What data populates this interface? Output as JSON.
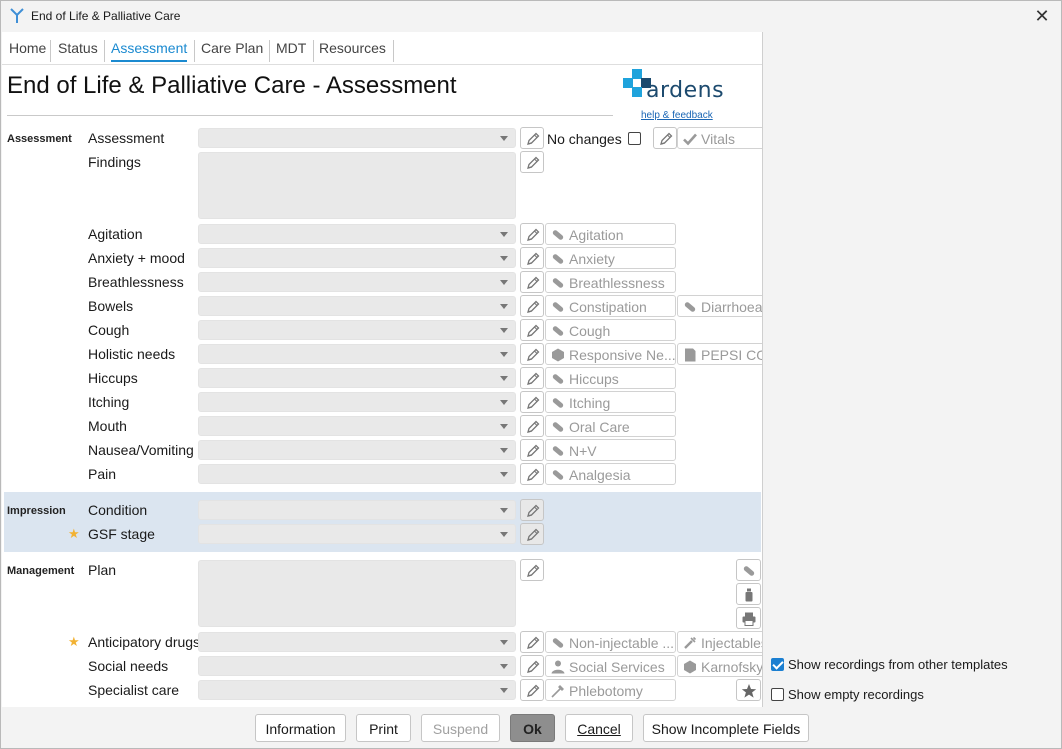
{
  "window": {
    "title": "End of Life & Palliative Care"
  },
  "tabs": [
    {
      "label": "Home"
    },
    {
      "label": "Status"
    },
    {
      "label": "Assessment"
    },
    {
      "label": "Care Plan"
    },
    {
      "label": "MDT"
    },
    {
      "label": "Resources"
    }
  ],
  "page": {
    "title": "End of Life & Palliative Care - Assessment"
  },
  "logo": {
    "text": "ardens",
    "help": "help & feedback"
  },
  "sections": {
    "assessment": "Assessment",
    "impression": "Impression",
    "management": "Management"
  },
  "assessment": {
    "rows": [
      {
        "label": "Assessment"
      },
      {
        "label": "Findings"
      },
      {
        "label": "Agitation"
      },
      {
        "label": "Anxiety + mood"
      },
      {
        "label": "Breathlessness"
      },
      {
        "label": "Bowels"
      },
      {
        "label": "Cough"
      },
      {
        "label": "Holistic needs"
      },
      {
        "label": "Hiccups"
      },
      {
        "label": "Itching"
      },
      {
        "label": "Mouth"
      },
      {
        "label": "Nausea/Vomiting"
      },
      {
        "label": "Pain"
      }
    ],
    "no_changes": "No changes",
    "tags": {
      "vitals": "Vitals",
      "agitation": "Agitation",
      "anxiety": "Anxiety",
      "breathlessness": "Breathlessness",
      "constipation": "Constipation",
      "diarrhoea": "Diarrhoea",
      "cough": "Cough",
      "responsive": "Responsive Ne...",
      "pepsi": "PEPSI CO",
      "hiccups": "Hiccups",
      "itching": "Itching",
      "oral_care": "Oral Care",
      "nv": "N+V",
      "analgesia": "Analgesia"
    }
  },
  "impression": {
    "rows": [
      {
        "label": "Condition"
      },
      {
        "label": "GSF stage"
      }
    ]
  },
  "management": {
    "rows": [
      {
        "label": "Plan"
      },
      {
        "label": "Anticipatory drugs"
      },
      {
        "label": "Social needs"
      },
      {
        "label": "Specialist care"
      }
    ],
    "tags": {
      "non_injectable": "Non-injectable ...",
      "injectables": "Injectables",
      "social_services": "Social Services",
      "karnofsky": "Karnofsky",
      "phlebotomy": "Phlebotomy"
    }
  },
  "options": {
    "show_other": "Show recordings from other templates",
    "show_other_checked": true,
    "show_empty": "Show empty recordings",
    "show_empty_checked": false
  },
  "buttons": {
    "information": "Information",
    "print": "Print",
    "suspend": "Suspend",
    "ok": "Ok",
    "cancel": "Cancel",
    "show_incomplete": "Show Incomplete Fields"
  },
  "colors": {
    "accent": "#1b8ad0",
    "band": "#dbe5f0",
    "star": "#f2b233"
  }
}
